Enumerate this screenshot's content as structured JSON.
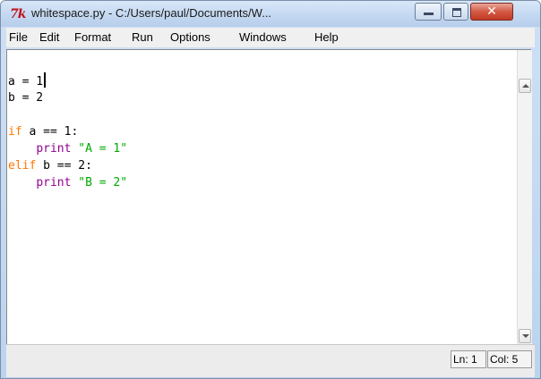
{
  "window": {
    "title": "whitespace.py - C:/Users/paul/Documents/W...",
    "logo_text": "7k",
    "controls": {
      "close_glyph": "✕"
    }
  },
  "menu": {
    "items": [
      "File",
      "Edit",
      "Format",
      "Run",
      "Options",
      "Windows",
      "Help"
    ]
  },
  "editor": {
    "lines": [
      "a = 1",
      "b = 2",
      "",
      "if a == 1:",
      "    print \"A = 1\"",
      "elif b == 2:",
      "    print \"B = 2\""
    ],
    "keyword_color": "#ff7700",
    "string_color": "#00aa00"
  },
  "status": {
    "line": "Ln: 1",
    "column": "Col: 5"
  }
}
